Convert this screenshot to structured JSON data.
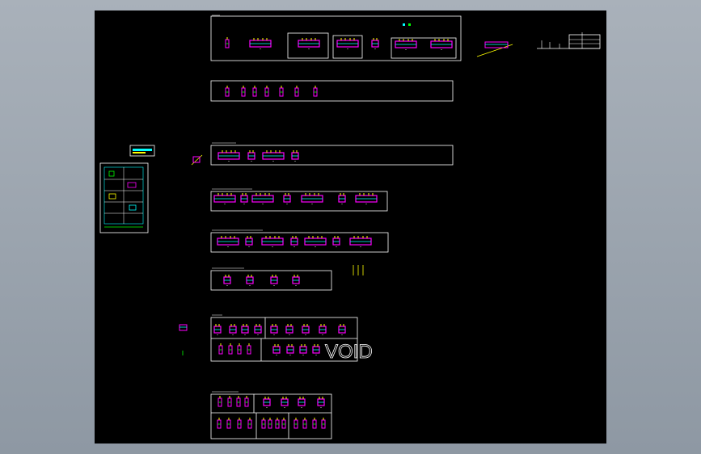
{
  "app": {
    "type": "cad-drawing-viewer"
  },
  "drawing": {
    "void_label": "VOID",
    "colors": {
      "background": "#000000",
      "frame": "#ffffff",
      "magenta": "#ff00ff",
      "yellow": "#ffff00",
      "cyan": "#00ffff",
      "green": "#00ff00",
      "blue": "#3050ff"
    },
    "sheet_count": 9
  }
}
